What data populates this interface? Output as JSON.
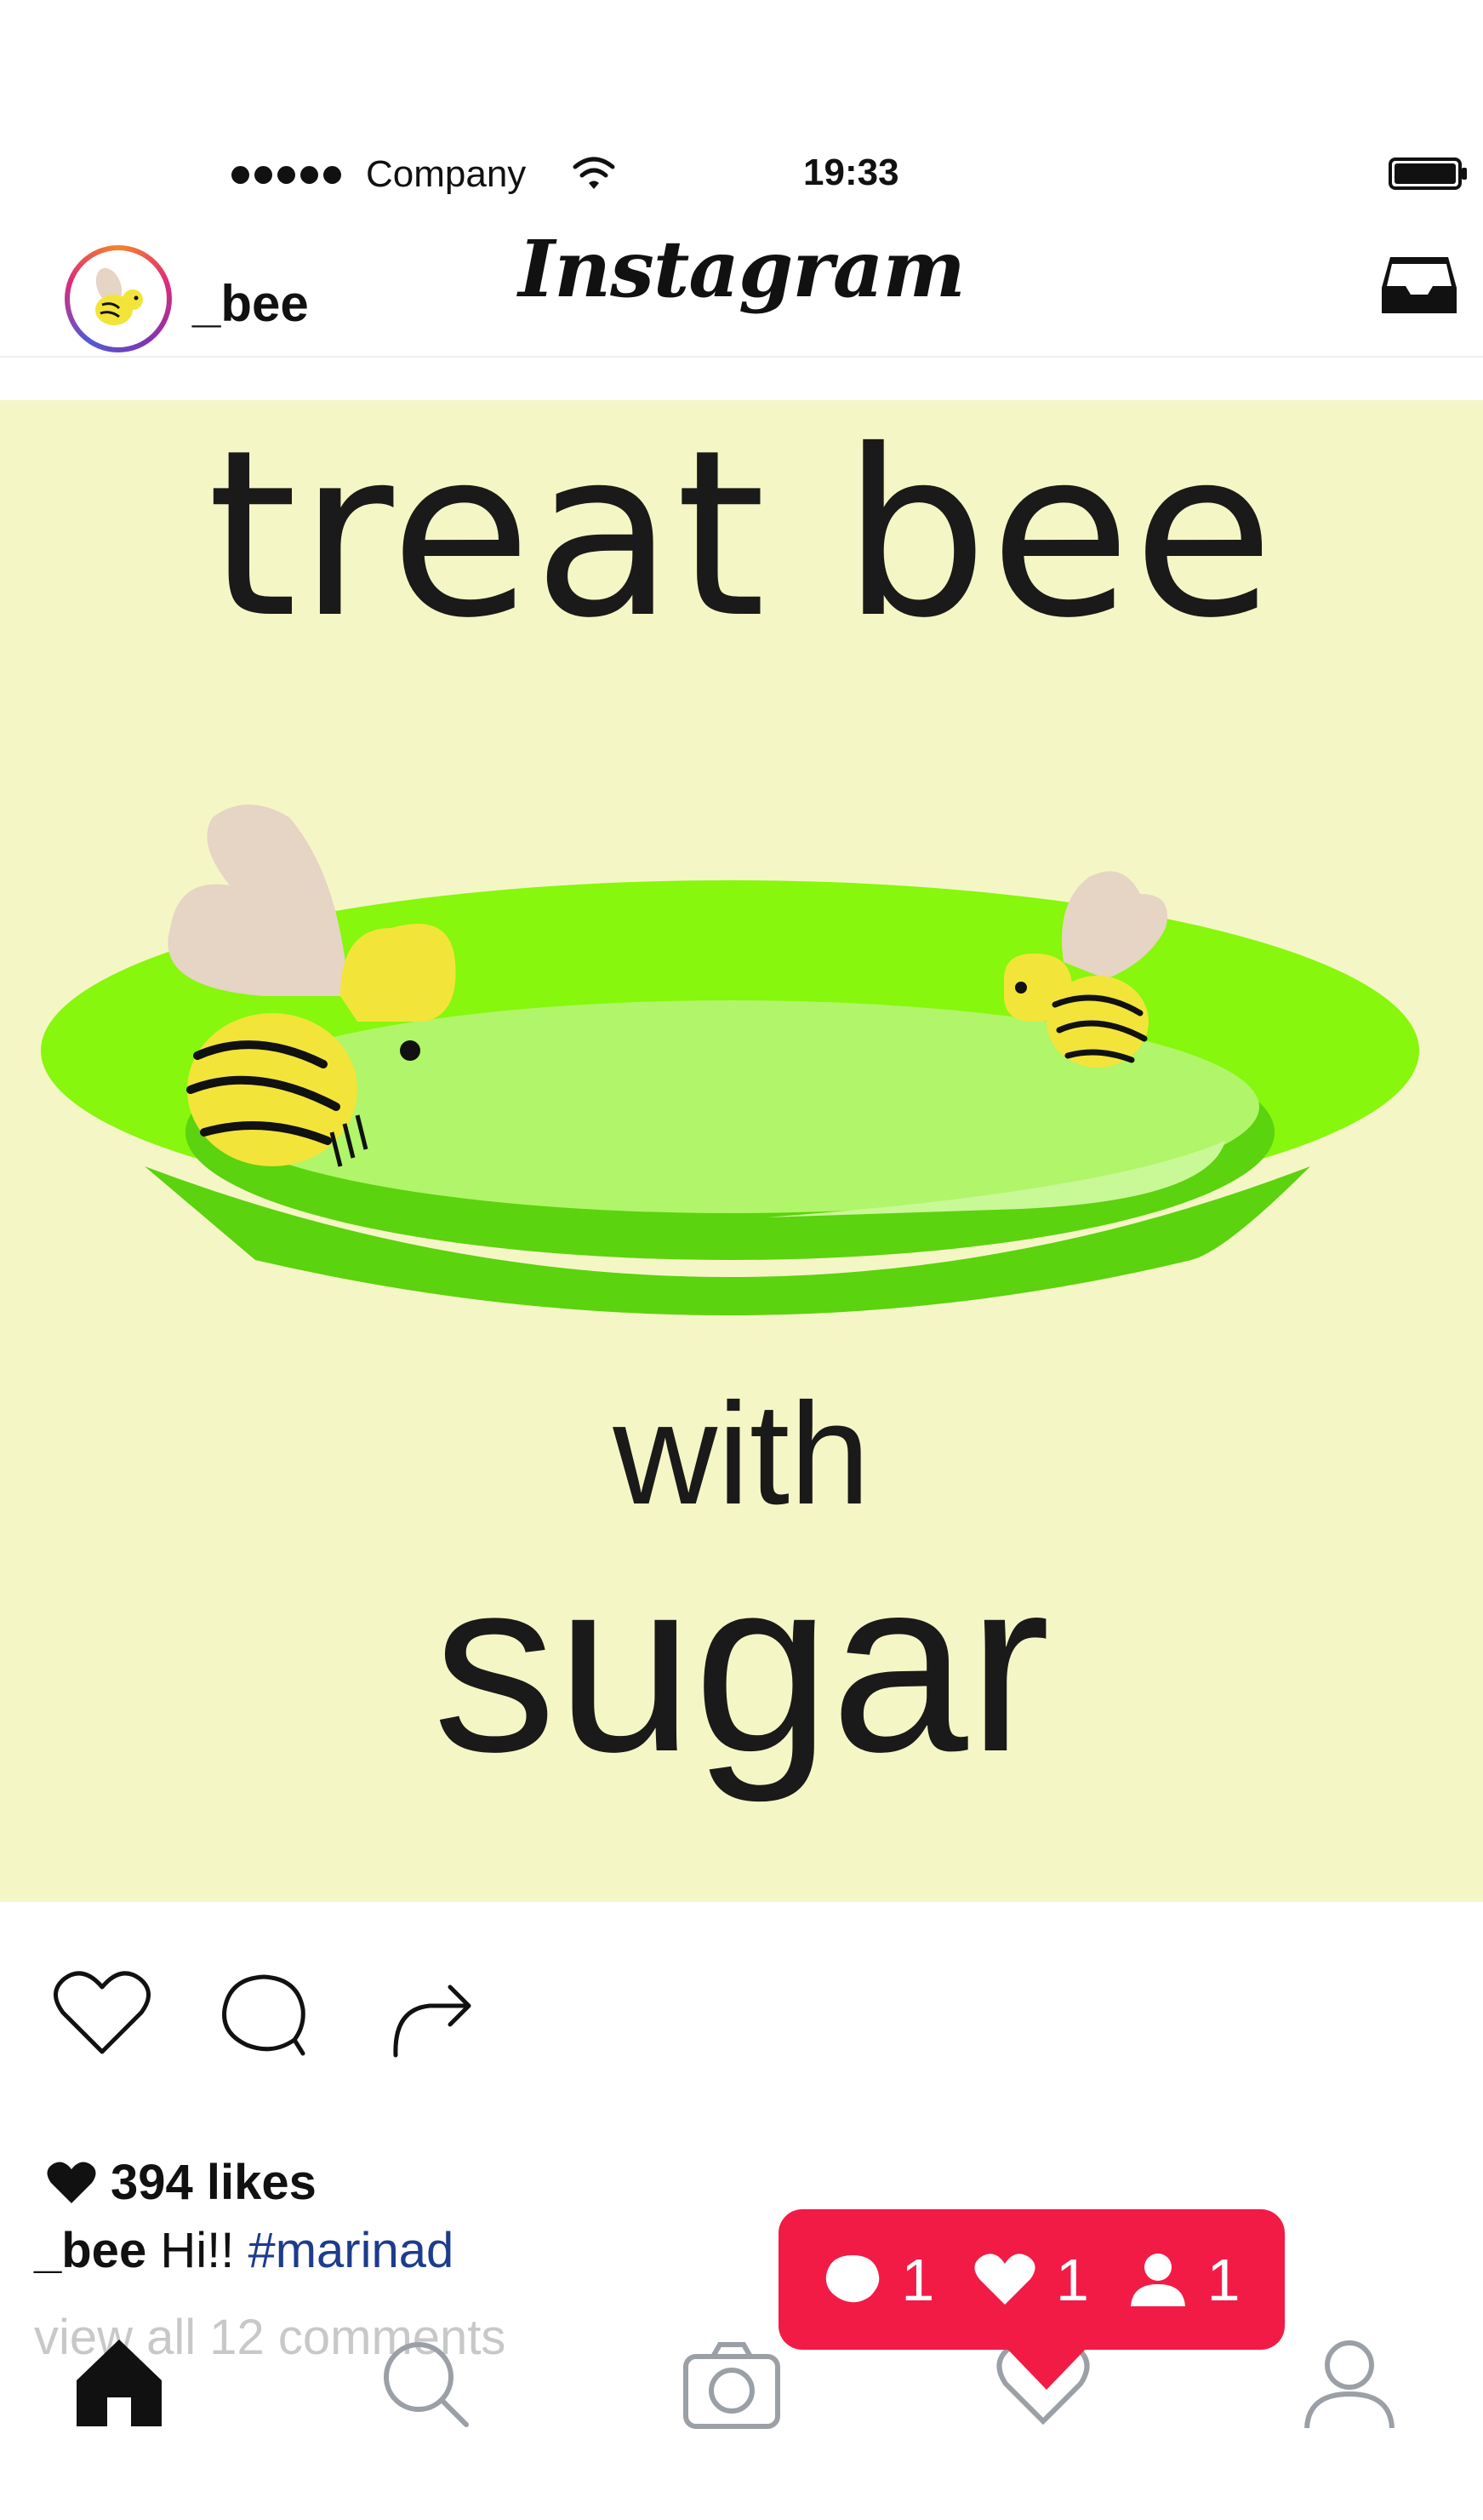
{
  "status_bar": {
    "carrier": "Company",
    "time": "19:33",
    "signal_bars": 5
  },
  "header": {
    "username": "_bee",
    "app_title": "Instagram",
    "avatar_icon": "bee-avatar-icon",
    "inbox_icon": "inbox-icon"
  },
  "post": {
    "image_text": {
      "title": "treat bee",
      "line2": "with",
      "line3": "sugar"
    },
    "background_color": "#f5f6c6",
    "plate_color": "#86f70d"
  },
  "actions": {
    "like_icon": "heart-outline-icon",
    "comment_icon": "comment-icon",
    "share_icon": "share-icon"
  },
  "engagement": {
    "likes_text": "394 likes",
    "caption_user": "_bee",
    "caption_text": "Hi!!",
    "caption_hashtag": "#marinad",
    "view_comments": "view all 12 comments"
  },
  "bottom_nav": {
    "items": [
      "home-icon",
      "search-icon",
      "camera-icon",
      "activity-heart-icon",
      "profile-icon"
    ]
  },
  "notification": {
    "comments": "1",
    "likes": "1",
    "followers": "1",
    "color": "#f21b45"
  }
}
